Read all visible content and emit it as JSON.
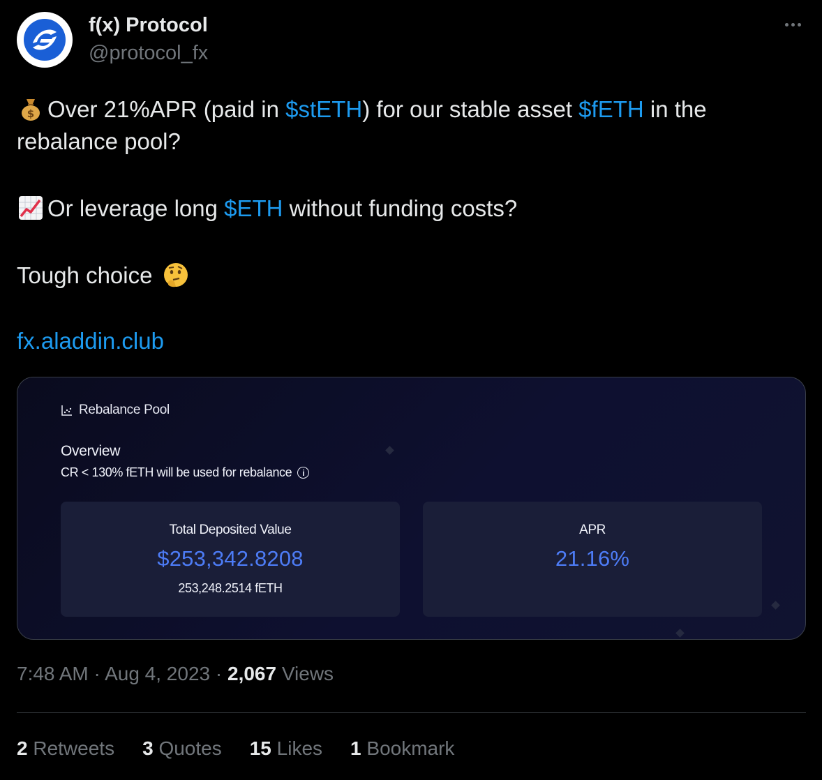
{
  "author": {
    "display_name": "f(x) Protocol",
    "handle": "@protocol_fx"
  },
  "tweet": {
    "line1": {
      "pre": "Over 21%APR (paid in ",
      "tag1": "$stETH",
      "mid": ") for our stable asset ",
      "tag2": "$fETH",
      "post": " in the"
    },
    "line2": "rebalance pool?",
    "line3": {
      "pre": "Or leverage long ",
      "tag": "$ETH",
      "post": " without funding costs?"
    },
    "line4": "Tough choice",
    "link": "fx.aladdin.club"
  },
  "card": {
    "title": "Rebalance Pool",
    "overview_title": "Overview",
    "overview_sub": "CR < 130% fETH will be used for rebalance",
    "deposit": {
      "label": "Total Deposited Value",
      "value": "$253,342.8208",
      "sub": "253,248.2514 fETH"
    },
    "apr": {
      "label": "APR",
      "value": "21.16%"
    },
    "accent_color": "#4d7cf6"
  },
  "meta": {
    "time": "7:48 AM",
    "date": "Aug 4, 2023",
    "views_count": "2,067",
    "views_label": "Views"
  },
  "stats": {
    "retweets_count": "2",
    "retweets_label": "Retweets",
    "quotes_count": "3",
    "quotes_label": "Quotes",
    "likes_count": "15",
    "likes_label": "Likes",
    "bookmarks_count": "1",
    "bookmarks_label": "Bookmark"
  },
  "colors": {
    "background": "#000000",
    "link": "#1d9bf0",
    "muted": "#71767b"
  }
}
